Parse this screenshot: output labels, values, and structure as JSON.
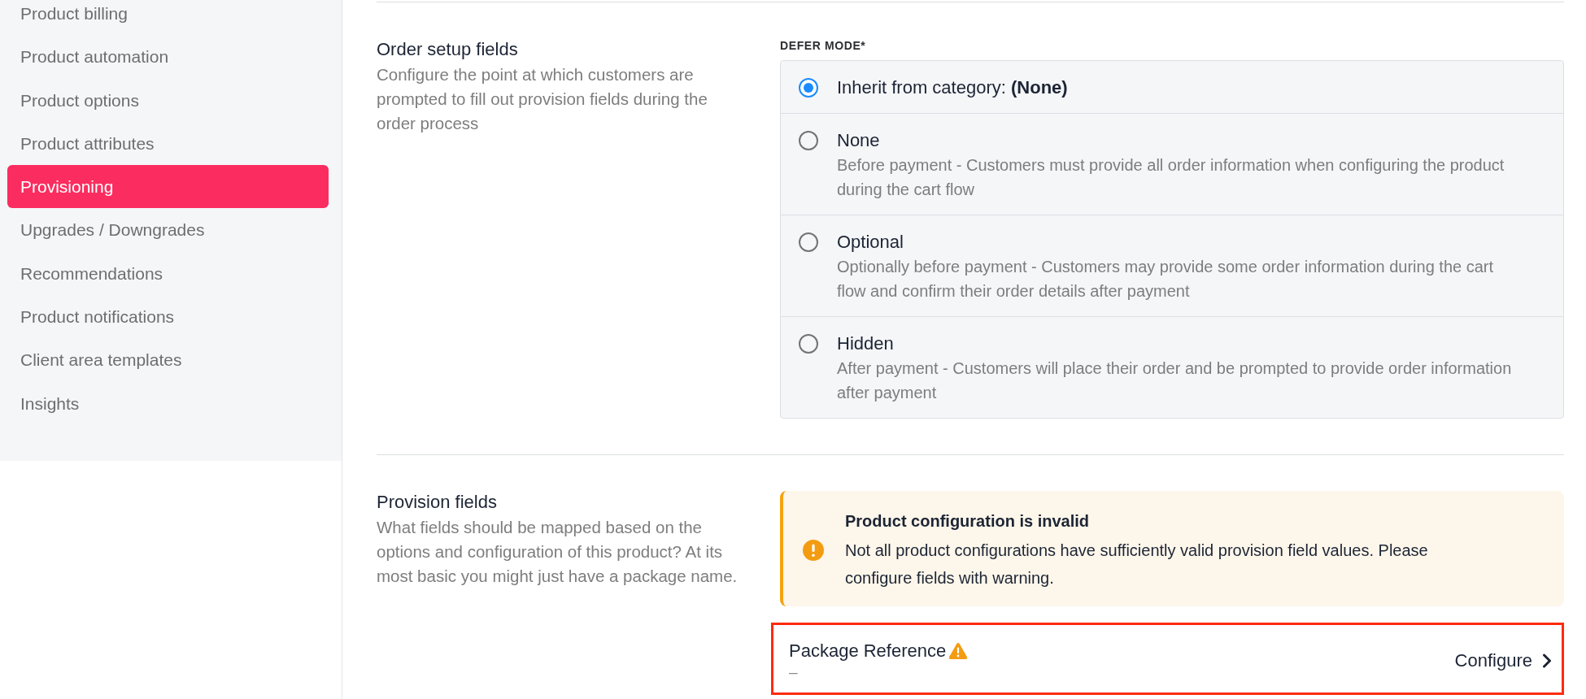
{
  "sidebar": {
    "items": [
      {
        "label": "Product billing",
        "selected": false
      },
      {
        "label": "Product automation",
        "selected": false
      },
      {
        "label": "Product options",
        "selected": false
      },
      {
        "label": "Product attributes",
        "selected": false
      },
      {
        "label": "Provisioning",
        "selected": true
      },
      {
        "label": "Upgrades / Downgrades",
        "selected": false
      },
      {
        "label": "Recommendations",
        "selected": false
      },
      {
        "label": "Product notifications",
        "selected": false
      },
      {
        "label": "Client area templates",
        "selected": false
      },
      {
        "label": "Insights",
        "selected": false
      }
    ]
  },
  "sections": [
    {
      "kind": "radio_group",
      "title": "Order setup fields",
      "description": "Configure the point at which customers are prompted to fill out provision fields during the order process",
      "field_label": "DEFER MODE*",
      "options": [
        {
          "label": "Inherit from category: **(None)**",
          "selected": true
        },
        {
          "label": "None",
          "description": "Before payment - Customers must provide all order information when configuring the product during the cart flow",
          "selected": false
        },
        {
          "label": "Optional",
          "description": "Optionally before payment - Customers may provide some order information during the cart flow and confirm their order details after payment",
          "selected": false
        },
        {
          "label": "Hidden",
          "description": "After payment - Customers will place their order and be prompted to provide order information after payment",
          "selected": false
        }
      ]
    },
    {
      "kind": "provision_fields",
      "title": "Provision fields",
      "description": "What fields should be mapped based on the options and configuration of this product? At its most basic you might just have a package name.",
      "alert": {
        "title": "Product configuration is invalid",
        "message": "Not all product configurations have sufficiently valid provision field values. Please configure fields with warning."
      },
      "fields": [
        {
          "name": "Package Reference",
          "warning": true,
          "value": "–",
          "action": "Configure",
          "highlighted": true
        }
      ]
    }
  ]
}
